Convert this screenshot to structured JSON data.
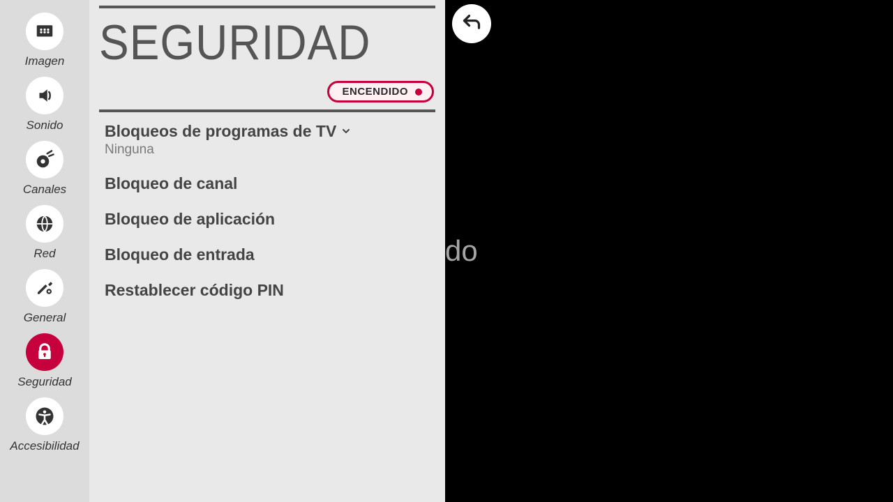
{
  "sidebar": {
    "items": [
      {
        "label": "Imagen"
      },
      {
        "label": "Sonido"
      },
      {
        "label": "Canales"
      },
      {
        "label": "Red"
      },
      {
        "label": "General"
      },
      {
        "label": "Seguridad"
      },
      {
        "label": "Accesibilidad"
      }
    ]
  },
  "panel": {
    "title": "SEGURIDAD",
    "toggle": {
      "label": "ENCENDIDO",
      "on": true
    }
  },
  "items": [
    {
      "title": "Bloqueos de programas de TV",
      "sub": "Ninguna",
      "expandable": true
    },
    {
      "title": "Bloqueo de canal"
    },
    {
      "title": "Bloqueo de aplicación"
    },
    {
      "title": "Bloqueo de entrada"
    },
    {
      "title": "Restablecer código PIN"
    }
  ],
  "background": {
    "partial_text": "do"
  }
}
